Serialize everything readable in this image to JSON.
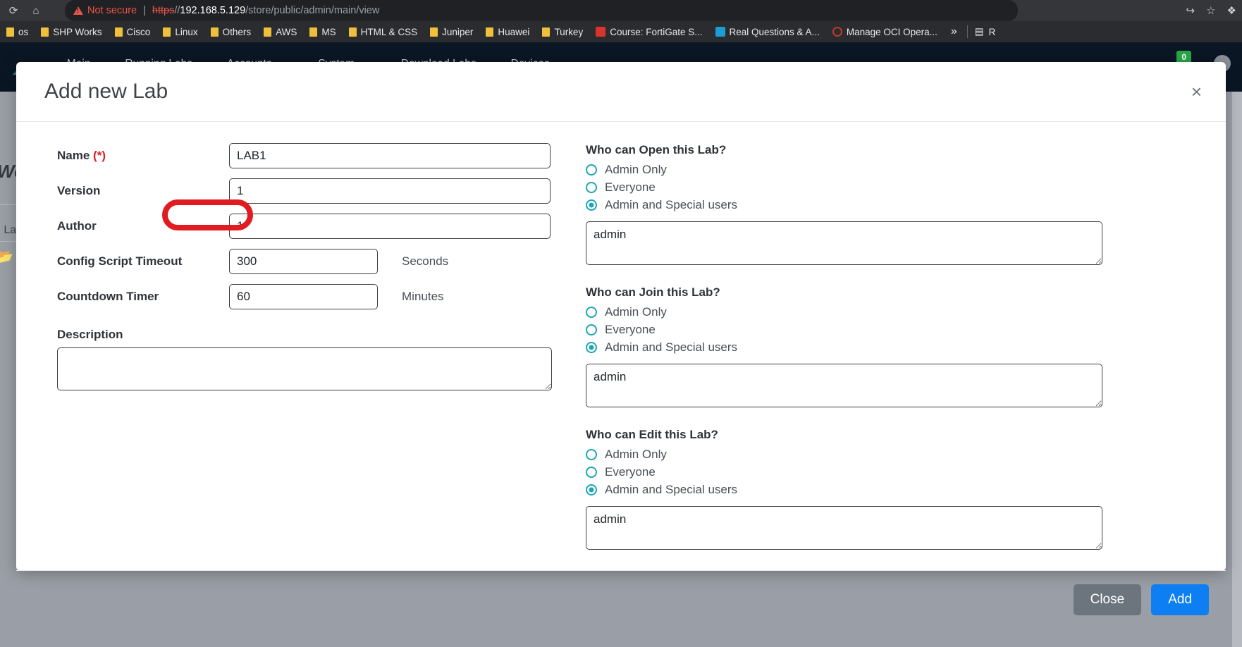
{
  "browser": {
    "nav_icons": [
      "reload-icon",
      "home-icon"
    ],
    "security_label": "Not secure",
    "url": {
      "scheme": "https",
      "separator": "//",
      "host": "192.168.5.129",
      "path": "/store/public/admin/main/view"
    },
    "toolbar_icons": [
      "share-icon",
      "bookmark-star-icon",
      "extensions-puzzle-icon"
    ],
    "bookmarks": [
      {
        "label": "os",
        "icon": "folder-icon",
        "type": "folder",
        "truncated": true
      },
      {
        "label": "SHP Works",
        "icon": "folder-icon",
        "type": "folder"
      },
      {
        "label": "Cisco",
        "icon": "folder-icon",
        "type": "folder"
      },
      {
        "label": "Linux",
        "icon": "folder-icon",
        "type": "folder"
      },
      {
        "label": "Others",
        "icon": "folder-icon",
        "type": "folder"
      },
      {
        "label": "AWS",
        "icon": "folder-icon",
        "type": "folder"
      },
      {
        "label": "MS",
        "icon": "folder-icon",
        "type": "folder"
      },
      {
        "label": "HTML & CSS",
        "icon": "folder-icon",
        "type": "folder"
      },
      {
        "label": "Juniper",
        "icon": "folder-icon",
        "type": "folder"
      },
      {
        "label": "Huawei",
        "icon": "folder-icon",
        "type": "folder"
      },
      {
        "label": "Turkey",
        "icon": "folder-icon",
        "type": "folder"
      },
      {
        "label": "Course: FortiGate S...",
        "icon": "site-icon-red",
        "type": "site"
      },
      {
        "label": "Real Questions & A...",
        "icon": "site-icon-blue",
        "type": "site"
      },
      {
        "label": "Manage OCI Opera...",
        "icon": "site-icon-ring",
        "type": "site"
      }
    ],
    "overflow_label": "»",
    "trailing": {
      "icon": "reading-list-icon",
      "label": "R"
    }
  },
  "app": {
    "nav_items": [
      {
        "label": "Main",
        "icon": "dashboard-icon",
        "has_caret": false
      },
      {
        "label": "Running Labs",
        "icon": "labs-icon",
        "has_caret": false
      },
      {
        "label": "Accounts",
        "icon": "users-icon",
        "has_caret": true
      },
      {
        "label": "System",
        "icon": "gear-icon",
        "has_caret": true
      },
      {
        "label": "Download Labs",
        "icon": "download-icon",
        "has_caret": false
      },
      {
        "label": "Devices",
        "icon": "devices-icon",
        "has_caret": false
      }
    ],
    "badge_count": "0",
    "page_title_fragment": "Wor",
    "side_text_fragment": "u La"
  },
  "modal": {
    "title": "Add new Lab",
    "close_icon": "×",
    "left_form": {
      "fields": [
        {
          "label": "Name",
          "required_marker": "(*)",
          "value": "LAB1",
          "placeholder": "",
          "width": "wide",
          "unit": "",
          "annotated": true
        },
        {
          "label": "Version",
          "required_marker": "",
          "value": "1",
          "placeholder": "",
          "width": "wide",
          "unit": ""
        },
        {
          "label": "Author",
          "required_marker": "",
          "value": "1",
          "placeholder": "",
          "width": "wide",
          "unit": ""
        },
        {
          "label": "Config Script Timeout",
          "required_marker": "",
          "value": "300",
          "placeholder": "",
          "width": "narrow",
          "unit": "Seconds"
        },
        {
          "label": "Countdown Timer",
          "required_marker": "",
          "value": "60",
          "placeholder": "",
          "width": "narrow",
          "unit": "Minutes"
        }
      ],
      "description_label": "Description",
      "description_value": "",
      "description_placeholder": ""
    },
    "permission_groups": [
      {
        "title": "Who can Open this Lab?",
        "options": [
          {
            "label": "Admin Only",
            "selected": false
          },
          {
            "label": "Everyone",
            "selected": false
          },
          {
            "label": "Admin and Special users",
            "selected": true
          }
        ],
        "users_value": "admin",
        "users_placeholder": ""
      },
      {
        "title": "Who can Join this Lab?",
        "options": [
          {
            "label": "Admin Only",
            "selected": false
          },
          {
            "label": "Everyone",
            "selected": false
          },
          {
            "label": "Admin and Special users",
            "selected": true
          }
        ],
        "users_value": "admin",
        "users_placeholder": ""
      },
      {
        "title": "Who can Edit this Lab?",
        "options": [
          {
            "label": "Admin Only",
            "selected": false
          },
          {
            "label": "Everyone",
            "selected": false
          },
          {
            "label": "Admin and Special users",
            "selected": true
          }
        ],
        "users_value": "admin",
        "users_placeholder": ""
      }
    ],
    "footer": {
      "close_label": "Close",
      "add_label": "Add"
    }
  },
  "colors": {
    "radio_accent": "#1aa6b7",
    "annotation": "#e01b22",
    "required": "#e02020",
    "primary_button": "#0d7ff2",
    "secondary_button": "#6c757d",
    "navbar": "#0b1624",
    "badge": "#28a745"
  }
}
